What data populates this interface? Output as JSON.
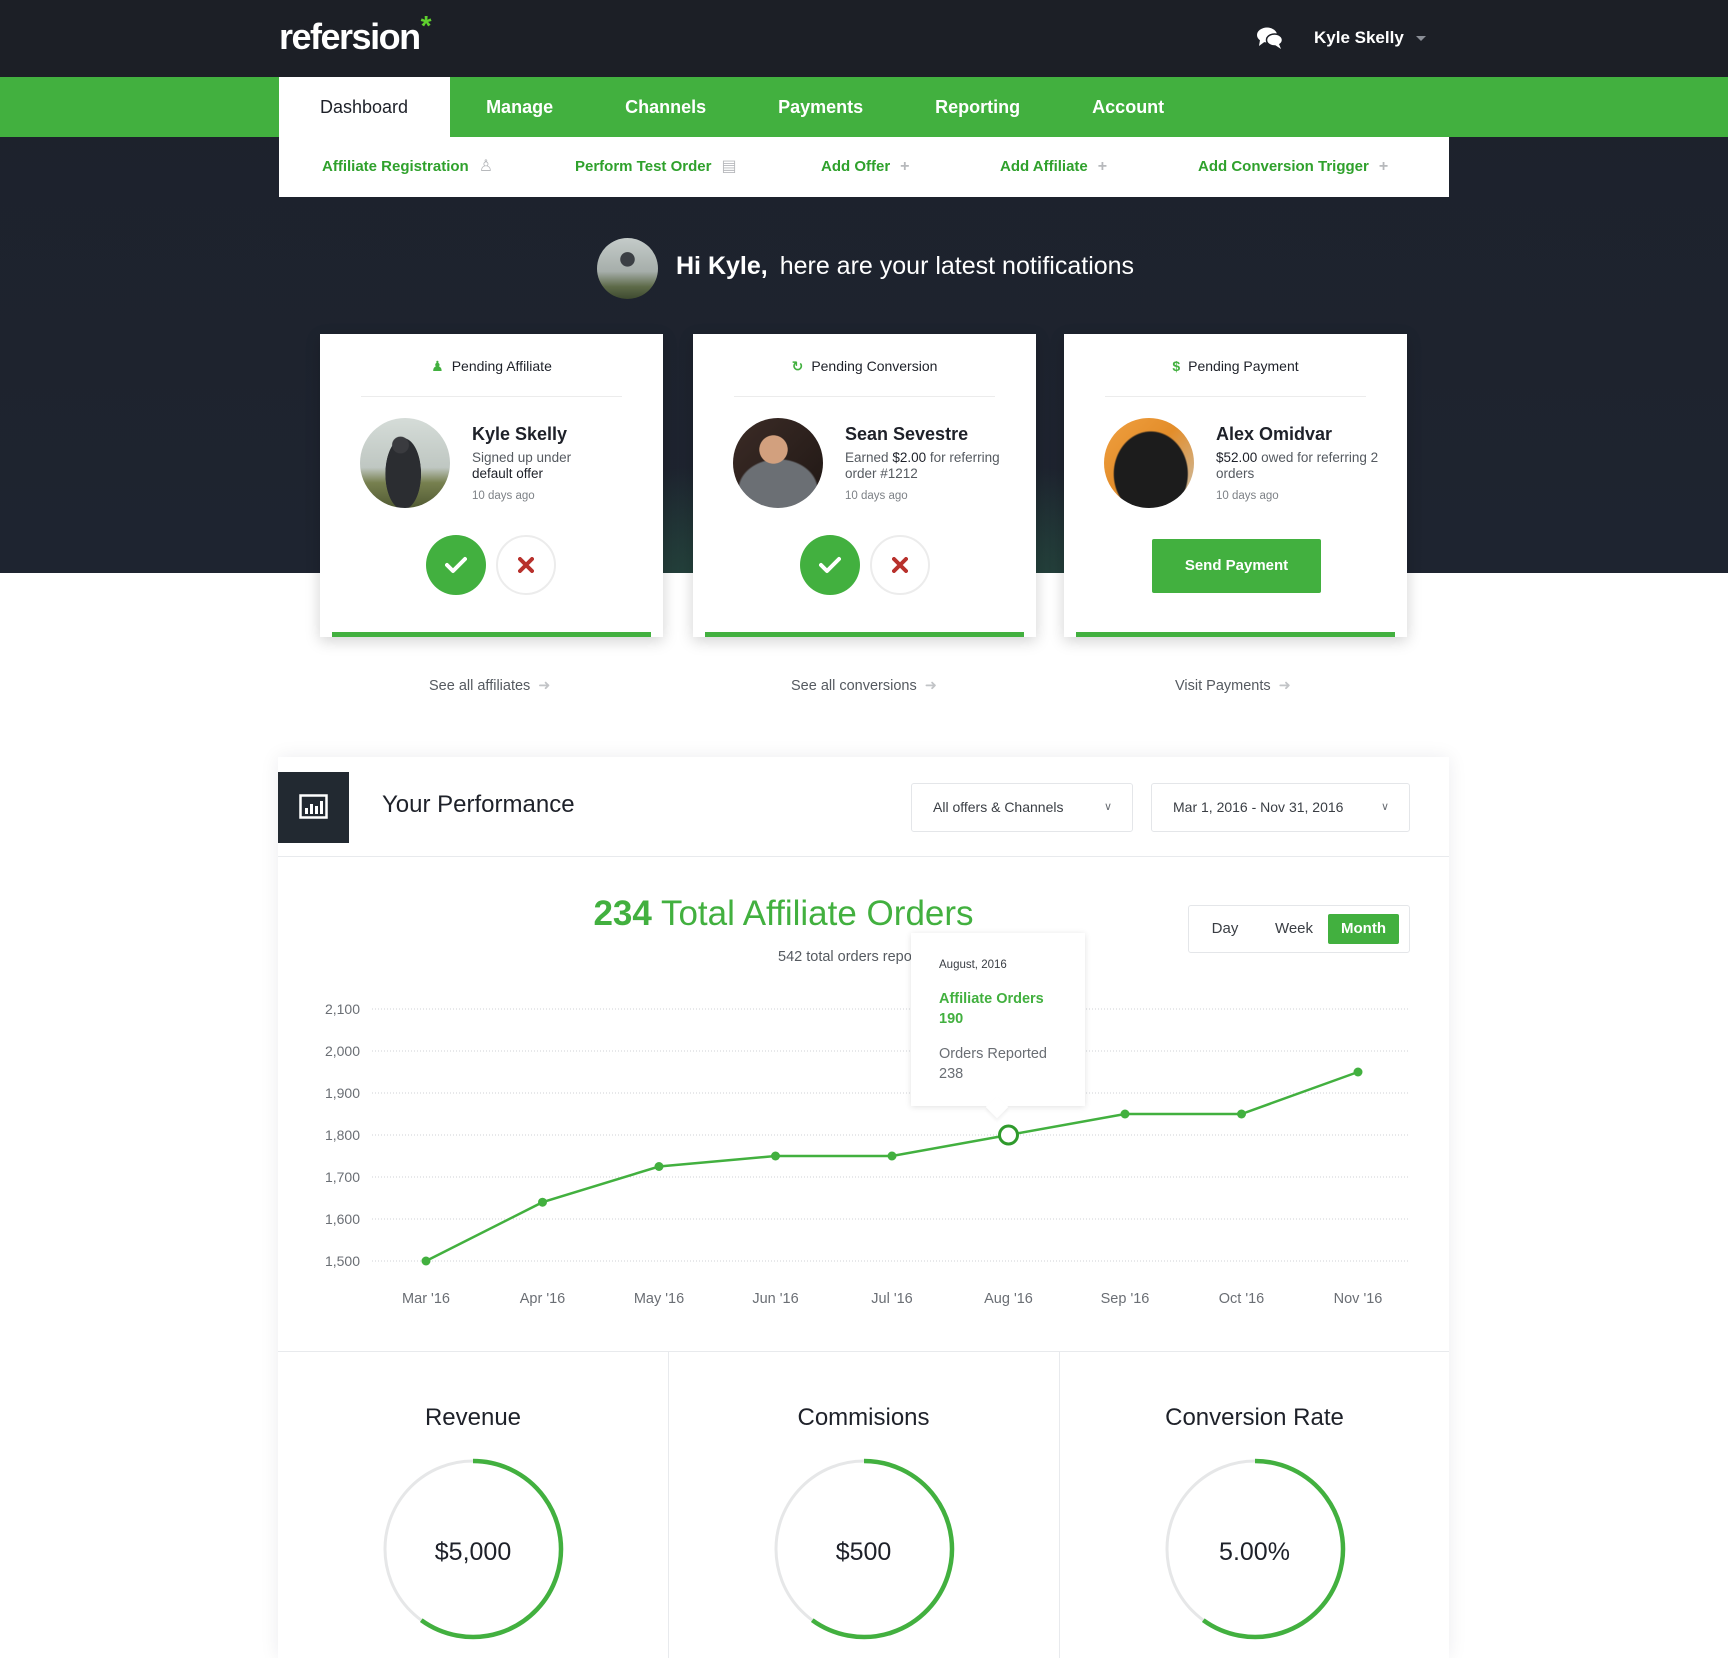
{
  "app": {
    "logo": "refersion",
    "logo_mark": "*",
    "user_name": "Kyle Skelly",
    "icons": {
      "messages": "chat-bubbles-icon",
      "user_menu": "caret-down-icon"
    }
  },
  "nav": {
    "items": [
      {
        "label": "Dashboard",
        "active": true
      },
      {
        "label": "Manage",
        "active": false
      },
      {
        "label": "Channels",
        "active": false
      },
      {
        "label": "Payments",
        "active": false
      },
      {
        "label": "Reporting",
        "active": false
      },
      {
        "label": "Account",
        "active": false
      }
    ]
  },
  "quick_actions": [
    {
      "label": "Affiliate Registration",
      "icon": "user-icon"
    },
    {
      "label": "Perform Test Order",
      "icon": "list-icon"
    },
    {
      "label": "Add Offer",
      "icon": "plus-icon"
    },
    {
      "label": "Add Affiliate",
      "icon": "plus-icon"
    },
    {
      "label": "Add Conversion Trigger",
      "icon": "plus-icon"
    }
  ],
  "greeting": {
    "hello": "Hi Kyle,",
    "message": "here are your latest notifications"
  },
  "cards": [
    {
      "header": "Pending Affiliate",
      "header_icon": "user-icon",
      "name": "Kyle Skelly",
      "desc_prefix": "Signed up under",
      "desc_strong": "default offer",
      "desc_suffix": "",
      "time": "10 days ago",
      "link": "See all affiliates"
    },
    {
      "header": "Pending Conversion",
      "header_icon": "refresh-icon",
      "name": "Sean Sevestre",
      "desc_prefix": "Earned",
      "desc_strong": "$2.00",
      "desc_suffix": "for referring order #1212",
      "time": "10 days ago",
      "link": "See all conversions"
    },
    {
      "header": "Pending Payment",
      "header_icon": "dollar-icon",
      "name": "Alex Omidvar",
      "desc_prefix": "",
      "desc_strong": "$52.00",
      "desc_suffix": "owed for referring 2 orders",
      "time": "10 days ago",
      "action": "Send Payment",
      "link": "Visit Payments"
    }
  ],
  "performance": {
    "title": "Your Performance",
    "filter_offers": "All offers & Channels",
    "filter_dates": "Mar 1, 2016 - Nov 31, 2016",
    "total_number": "234",
    "total_label": "Total Affiliate Orders",
    "subtotal": "542 total orders reported",
    "range_options": [
      "Day",
      "Week",
      "Month"
    ],
    "range_selected": "Month",
    "tooltip": {
      "date": "August, 2016",
      "affiliate_label": "Affiliate Orders",
      "affiliate_value": "190",
      "reported_label": "Orders Reported",
      "reported_value": "238"
    }
  },
  "chart_data": {
    "type": "line",
    "title": "234 Total Affiliate Orders",
    "subtitle": "542 total orders reported",
    "categories": [
      "Mar '16",
      "Apr '16",
      "May '16",
      "Jun '16",
      "Jul '16",
      "Aug '16",
      "Sep '16",
      "Oct '16",
      "Nov '16"
    ],
    "series": [
      {
        "name": "Affiliate Orders",
        "values": [
          1500,
          1640,
          1725,
          1750,
          1750,
          1800,
          1850,
          1850,
          1950
        ]
      }
    ],
    "highlighted_index": 5,
    "ylim": [
      1500,
      2100
    ],
    "yticks": [
      1500,
      1600,
      1700,
      1800,
      1900,
      2000,
      2100
    ],
    "ytick_labels": [
      "1,500",
      "1,600",
      "1,700",
      "1,800",
      "1,900",
      "2,000",
      "2,100"
    ],
    "grid": true,
    "xlabel": "",
    "ylabel": "",
    "color": "#42b03f"
  },
  "metrics": [
    {
      "title": "Revenue",
      "value": "$5,000",
      "progress": 0.6
    },
    {
      "title": "Commisions",
      "value": "$500",
      "progress": 0.6
    },
    {
      "title": "Conversion Rate",
      "value": "5.00%",
      "progress": 0.6
    }
  ],
  "colors": {
    "brand_green": "#42b03f",
    "dark": "#1c1f26",
    "reject_red": "#b8312c"
  }
}
